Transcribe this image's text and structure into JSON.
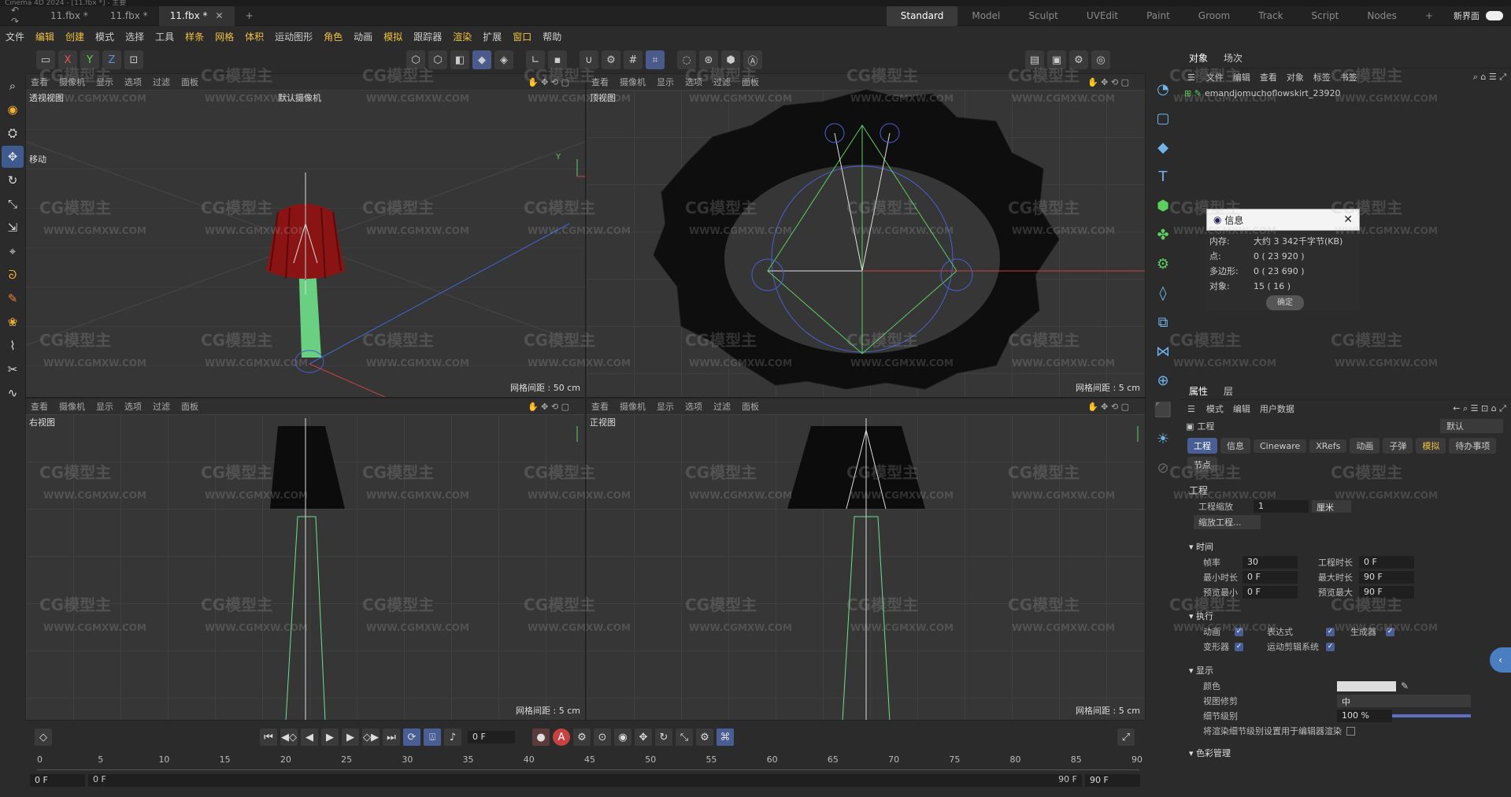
{
  "titlebar": {
    "text": "Cinema 4D 2024 - [11.fbx *] - 主要"
  },
  "file_tabs": [
    {
      "label": "11.fbx *"
    },
    {
      "label": "11.fbx *"
    },
    {
      "label": "11.fbx *",
      "active": true
    }
  ],
  "layout_tabs": [
    "Standard",
    "Model",
    "Sculpt",
    "UVEdit",
    "Paint",
    "Groom",
    "Track",
    "Script",
    "Nodes"
  ],
  "layout_active": "Standard",
  "new_interface": "新界面",
  "menu": [
    "文件",
    "编辑",
    "创建",
    "模式",
    "选择",
    "工具",
    "样条",
    "网格",
    "体积",
    "运动图形",
    "角色",
    "动画",
    "模拟",
    "跟踪器",
    "渲染",
    "扩展",
    "窗口",
    "帮助"
  ],
  "toolbar": {
    "x": "X",
    "y": "Y",
    "z": "Z"
  },
  "viewports": [
    {
      "id": "perspective",
      "title": "透视视图",
      "camera": "默认摄像机",
      "grid": "网格间距 : 50 cm",
      "menu": [
        "查看",
        "摄像机",
        "显示",
        "选项",
        "过滤",
        "面板"
      ],
      "move_label": "移动"
    },
    {
      "id": "top",
      "title": "顶视图",
      "grid": "网格间距 : 5 cm",
      "menu": [
        "查看",
        "摄像机",
        "显示",
        "选项",
        "过滤",
        "面板"
      ]
    },
    {
      "id": "right",
      "title": "右视图",
      "grid": "网格间距 : 5 cm",
      "menu": [
        "查看",
        "摄像机",
        "显示",
        "选项",
        "过滤",
        "面板"
      ]
    },
    {
      "id": "front",
      "title": "正视图",
      "grid": "网格间距 : 5 cm",
      "menu": [
        "查看",
        "摄像机",
        "显示",
        "选项",
        "过滤",
        "面板"
      ]
    }
  ],
  "object_panel": {
    "tabs": [
      "对象",
      "场次"
    ],
    "menu": [
      "文件",
      "编辑",
      "查看",
      "对象",
      "标签",
      "书签"
    ],
    "object_name": "emandjomuchoflowskirt_23920"
  },
  "info_dialog": {
    "title": "信息",
    "rows": [
      {
        "label": "内存:",
        "value": "大约 3 342千字节(KB)"
      },
      {
        "label": "点:",
        "value": "0 ( 23 920 )"
      },
      {
        "label": "多边形:",
        "value": "0 ( 23 690 )"
      },
      {
        "label": "对象:",
        "value": "15 ( 16 )"
      }
    ],
    "ok": "确定"
  },
  "attributes": {
    "tabs": [
      "属性",
      "层"
    ],
    "menu": [
      "模式",
      "编辑",
      "用户数据"
    ],
    "header": "工程",
    "preset": "默认",
    "subtabs": [
      "工程",
      "信息",
      "Cineware",
      "XRefs",
      "动画",
      "子弹",
      "模拟",
      "待办事项",
      "节点"
    ],
    "section_project": "工程",
    "project_scale_label": "工程缩放",
    "project_scale_value": "1",
    "project_scale_unit": "厘米",
    "scale_project_btn": "缩放工程...",
    "time_section": "时间",
    "fps_label": "帧率",
    "fps": "30",
    "proj_len_label": "工程时长",
    "proj_len": "0 F",
    "min_len_label": "最小时长",
    "min_len": "0 F",
    "max_len_label": "最大时长",
    "max_len": "90 F",
    "prev_min_label": "预览最小",
    "prev_min": "0 F",
    "prev_max_label": "预览最大",
    "prev_max": "90 F",
    "exec_section": "执行",
    "exec_items": [
      "动画",
      "表达式",
      "生成器",
      "变形器",
      "运动剪辑系统"
    ],
    "display_section": "显示",
    "color_label": "颜色",
    "view_clip_label": "视图修剪",
    "view_clip_value": "中",
    "lod_label": "细节级别",
    "lod_value": "100 %",
    "render_lod_label": "将渲染细节级别设置用于编辑器渲染",
    "color_mgmt": "色彩管理"
  },
  "timeline": {
    "frame_field": "0 F",
    "ticks": [
      "0",
      "5",
      "10",
      "15",
      "20",
      "25",
      "30",
      "35",
      "40",
      "45",
      "50",
      "55",
      "60",
      "65",
      "70",
      "75",
      "80",
      "85",
      "90"
    ],
    "start": "0 F",
    "range_start": "0 F",
    "range_end": "90 F",
    "end": "90 F"
  },
  "watermarks": {
    "logo": "CG模型主",
    "url": "WWW.CGMXW.COM"
  }
}
